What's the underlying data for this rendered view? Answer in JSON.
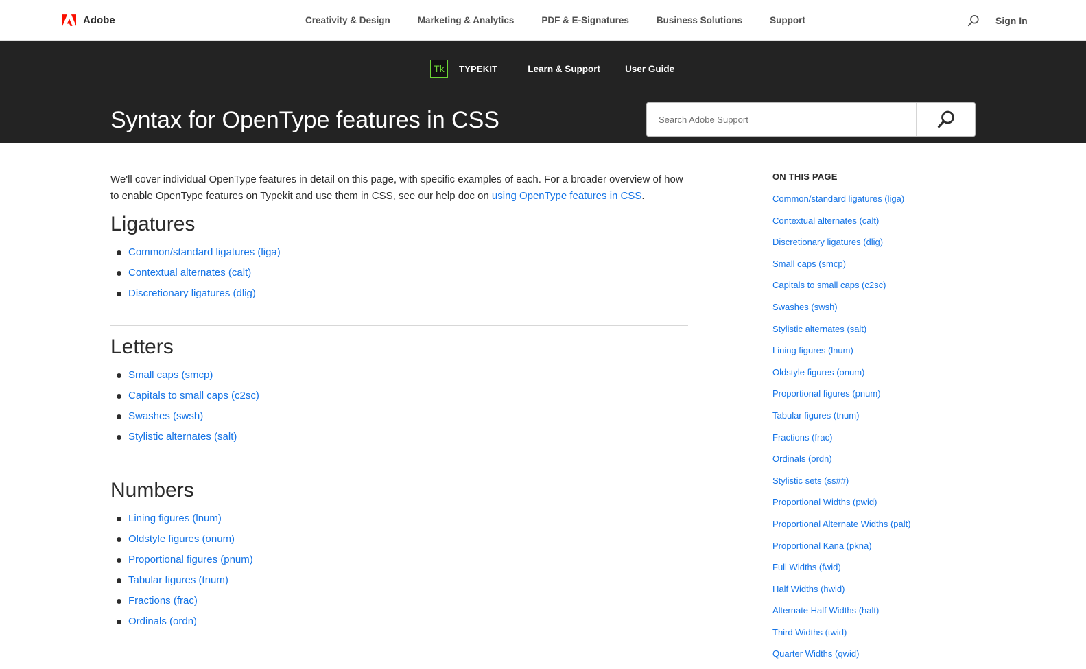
{
  "topnav": {
    "brand": "Adobe",
    "links": [
      "Creativity & Design",
      "Marketing & Analytics",
      "PDF & E-Signatures",
      "Business Solutions",
      "Support"
    ],
    "signin": "Sign In",
    "search_icon": "search-icon"
  },
  "hero": {
    "product_logo": "Tk",
    "product_name": "TYPEKIT",
    "links": [
      "Learn & Support",
      "User Guide"
    ],
    "title": "Syntax for OpenType features in CSS",
    "search_placeholder": "Search Adobe Support"
  },
  "main": {
    "intro_text": "We'll cover individual OpenType features in detail on this page, with specific examples of each. For a broader overview of how to enable OpenType features on Typekit and use them in CSS, see our help doc on ",
    "intro_link": "using OpenType features in CSS",
    "intro_end": ".",
    "sections": [
      {
        "title": "Ligatures",
        "items": [
          "Common/standard ligatures (liga)",
          "Contextual alternates (calt)",
          "Discretionary ligatures (dlig)"
        ]
      },
      {
        "title": "Letters",
        "items": [
          "Small caps (smcp)",
          "Capitals to small caps (c2sc)",
          "Swashes (swsh)",
          "Stylistic alternates (salt)"
        ]
      },
      {
        "title": "Numbers",
        "items": [
          "Lining figures (lnum)",
          "Oldstyle figures (onum)",
          "Proportional figures (pnum)",
          "Tabular figures (tnum)",
          "Fractions (frac)",
          "Ordinals (ordn)"
        ]
      }
    ]
  },
  "toc": {
    "heading": "ON THIS PAGE",
    "items": [
      "Common/standard ligatures (liga)",
      "Contextual alternates (calt)",
      "Discretionary ligatures (dlig)",
      "Small caps (smcp)",
      "Capitals to small caps (c2sc)",
      "Swashes (swsh)",
      "Stylistic alternates (salt)",
      "Lining figures (lnum)",
      "Oldstyle figures (onum)",
      "Proportional figures (pnum)",
      "Tabular figures (tnum)",
      "Fractions (frac)",
      "Ordinals (ordn)",
      "Stylistic sets (ss##)",
      "Proportional Widths (pwid)",
      "Proportional Alternate Widths (palt)",
      "Proportional Kana (pkna)",
      "Full Widths (fwid)",
      "Half Widths (hwid)",
      "Alternate Half Widths (halt)",
      "Third Widths (twid)",
      "Quarter Widths (qwid)"
    ]
  },
  "colors": {
    "link": "#1473e6",
    "hero_bg": "#232323",
    "brand_red": "#fa0f00",
    "typekit_green": "#6bd436"
  }
}
